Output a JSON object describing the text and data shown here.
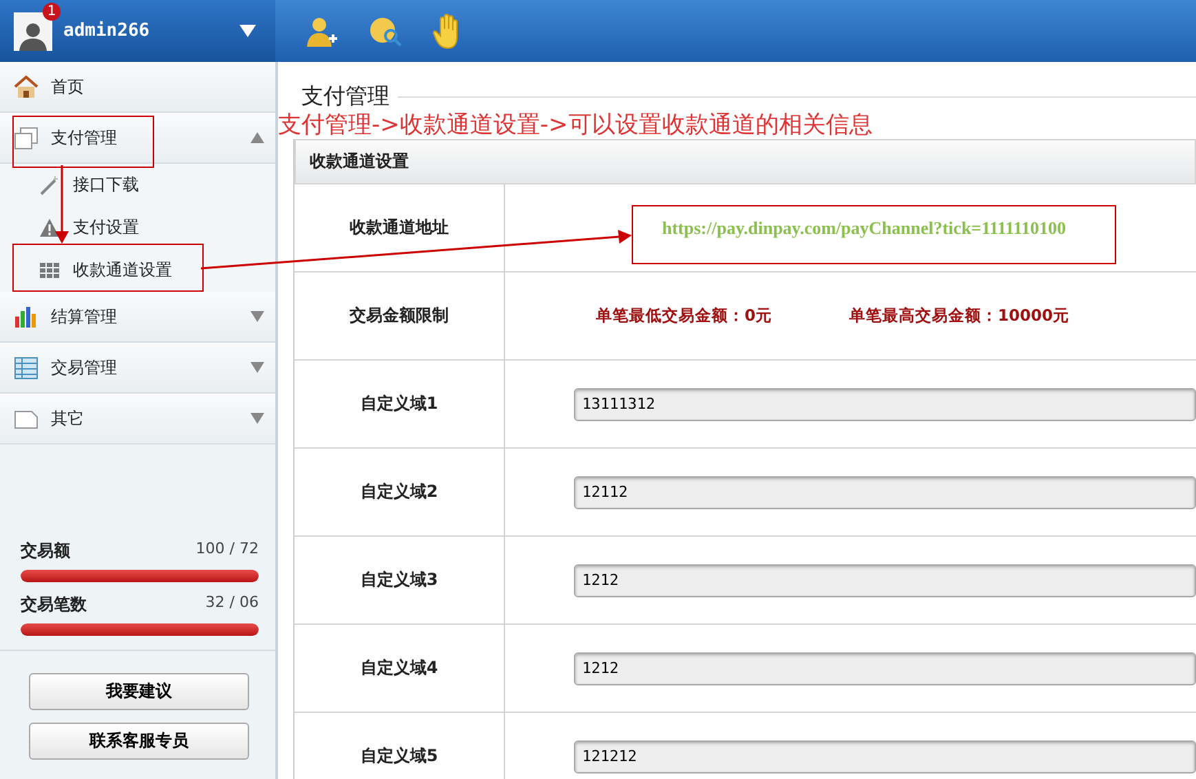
{
  "user": {
    "name": "admin266",
    "badge": "1"
  },
  "sidebar": {
    "items": [
      {
        "label": "首页"
      },
      {
        "label": "支付管理",
        "expanded": true,
        "children": [
          {
            "label": "接口下载"
          },
          {
            "label": "支付设置"
          },
          {
            "label": "收款通道设置"
          }
        ]
      },
      {
        "label": "结算管理",
        "expanded": false
      },
      {
        "label": "交易管理",
        "expanded": false
      },
      {
        "label": "其它",
        "expanded": false
      }
    ]
  },
  "stats": [
    {
      "label": "交易额",
      "reading": "100 / 72",
      "level": 1
    },
    {
      "label": "交易笔数",
      "reading": "32 / 06",
      "level": 1
    }
  ],
  "buttons": [
    "我要建议",
    "联系客服专员"
  ],
  "page_title": "支付管理",
  "annotation": "支付管理->收款通道设置->可以设置收款通道的相关信息",
  "panel": {
    "title": "收款通道设置",
    "rows": [
      {
        "kind": "link",
        "label": "收款通道地址",
        "value": "https://pay.dinpay.com/payChannel?tick=1111110100"
      },
      {
        "kind": "limits",
        "label": "交易金额限制",
        "values": [
          "单笔最低交易金额：0元",
          "单笔最高交易金额：10000元"
        ]
      },
      {
        "kind": "field",
        "label": "自定义域1",
        "value": "13111312"
      },
      {
        "kind": "field",
        "label": "自定义域2",
        "value": "12112"
      },
      {
        "kind": "field",
        "label": "自定义域3",
        "value": "1212"
      },
      {
        "kind": "field",
        "label": "自定义域4",
        "value": "1212"
      },
      {
        "kind": "field",
        "label": "自定义域5",
        "value": "121212"
      }
    ]
  }
}
